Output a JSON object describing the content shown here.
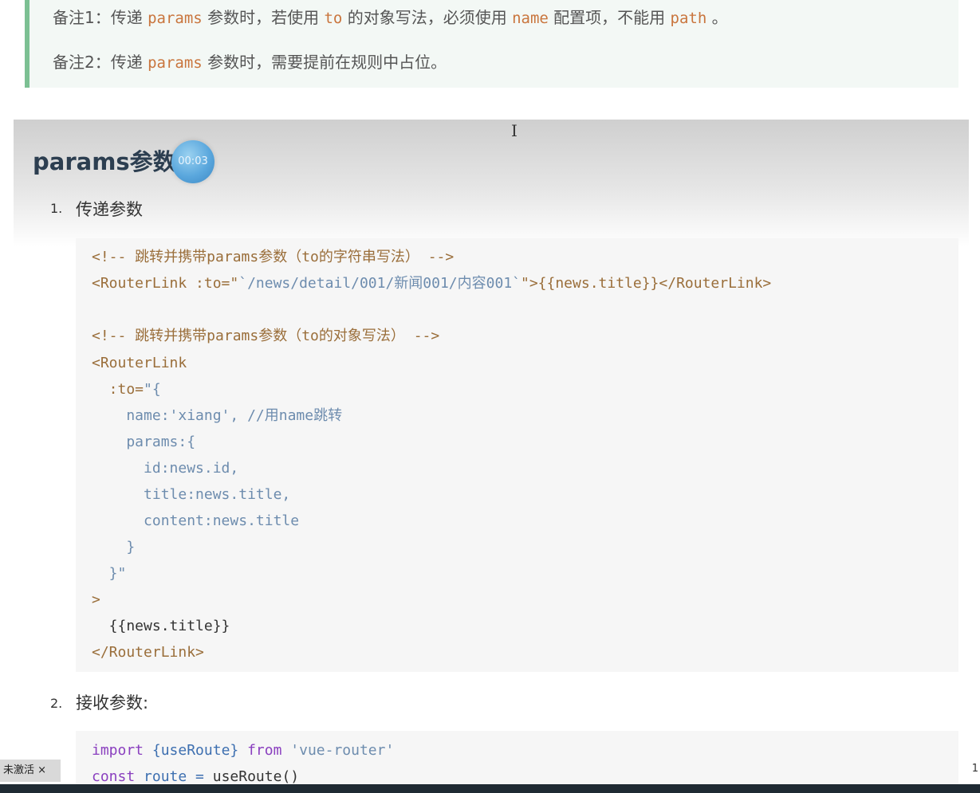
{
  "note": {
    "line1": {
      "p1": "备注1：传递 ",
      "k1": "params",
      "p2": " 参数时，若使用 ",
      "k2": "to",
      "p3": " 的对象写法，必须使用 ",
      "k3": "name",
      "p4": " 配置项，不能用 ",
      "k4": "path",
      "p5": " 。"
    },
    "line2": {
      "p1": "备注2：传递 ",
      "k1": "params",
      "p2": " 参数时，需要提前在规则中占位。"
    }
  },
  "cursor_glyph": "I",
  "section_title": "params参数",
  "timer_text": "00:03",
  "list": [
    {
      "num": "1.",
      "text": "传递参数"
    },
    {
      "num": "2.",
      "text": "接收参数:"
    }
  ],
  "code1": {
    "l1": "<!-- 跳转并携带params参数（to的字符串写法） -->",
    "l2a": "<RouterLink :to=\"",
    "l2b": "`/news/detail/001/新闻001/内容001`",
    "l2c": "\">{{news.title}}</RouterLink>",
    "l4": "<!-- 跳转并携带params参数（to的对象写法） -->",
    "l5": "<RouterLink",
    "l6a": "  :to=",
    "l6b": "\"{",
    "l7": "    name:'xiang', //用name跳转",
    "l8": "    params:{",
    "l9": "      id:news.id,",
    "l10": "      title:news.title,",
    "l11": "      content:news.title",
    "l12": "    }",
    "l13": "  }\"",
    "l14": ">",
    "l15": "  {{news.title}}",
    "l16": "</RouterLink>"
  },
  "code2": {
    "l1a": "import",
    "l1b": " {useRoute} ",
    "l1c": "from",
    "l1d": " 'vue-router'",
    "l2a": "const",
    "l2b": " route = ",
    "l2c": "useRoute",
    "l2d": "()"
  },
  "badge_text": "未激活 ×",
  "page_number": "1"
}
